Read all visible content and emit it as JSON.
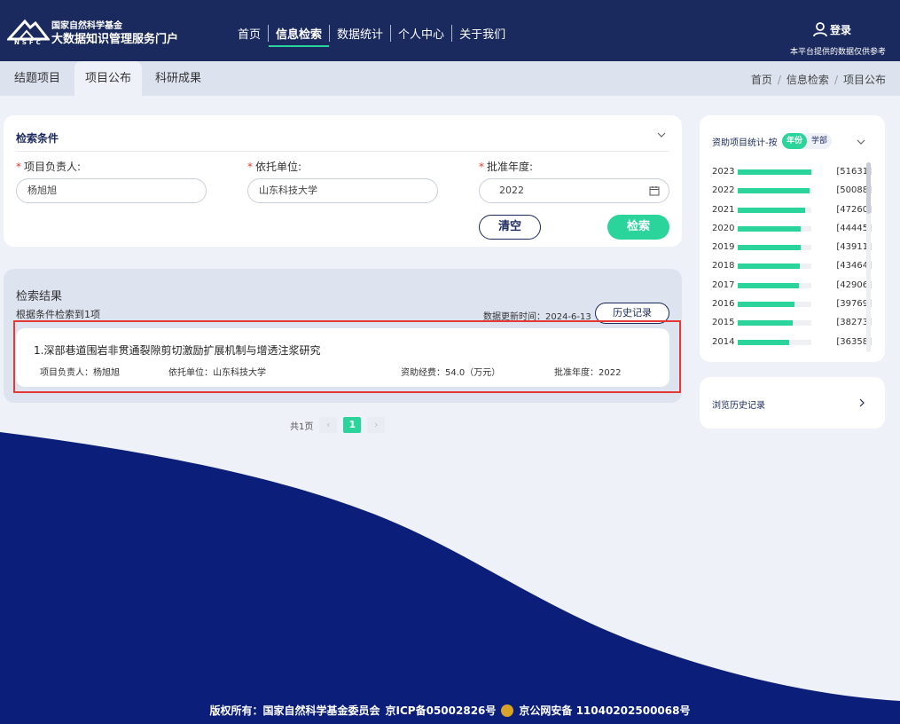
{
  "header": {
    "logo_abbr": "NSFC",
    "logo_line1": "国家自然科学基金",
    "logo_line2": "大数据知识管理服务门户",
    "nav": [
      "首页",
      "信息检索",
      "数据统计",
      "个人中心",
      "关于我们"
    ],
    "nav_active": "信息检索",
    "login_label": "登录",
    "disclaimer": "本平台提供的数据仅供参考"
  },
  "tabs": [
    "结题项目",
    "项目公布",
    "科研成果"
  ],
  "tab_active": "项目公布",
  "breadcrumb": [
    "首页",
    "信息检索",
    "项目公布"
  ],
  "search": {
    "title": "检索条件",
    "fields": [
      {
        "label": "项目负责人:",
        "value": "杨旭旭",
        "required": "*"
      },
      {
        "label": "依托单位:",
        "value": "山东科技大学",
        "required": "*"
      },
      {
        "label": "批准年度:",
        "value": "2022",
        "required": "*"
      }
    ],
    "clear_label": "清空",
    "search_label": "检索"
  },
  "results": {
    "title": "检索结果",
    "count_text": "根据条件检索到1项",
    "update_text": "数据更新时间：2024-6-13",
    "history_label": "历史记录",
    "items": [
      {
        "title": "1.深部巷道围岩非贯通裂隙剪切激励扩展机制与增透注浆研究",
        "leader": "项目负责人：杨旭旭",
        "unit": "依托单位：山东科技大学",
        "funding": "资助经费：54.0（万元）",
        "year": "批准年度：2022"
      }
    ]
  },
  "pager": {
    "total_text": "共1页",
    "prev": "‹",
    "current": "1",
    "next": "›"
  },
  "stats": {
    "title": "资助项目统计-按",
    "toggle_on": "年份",
    "toggle_off": "学部",
    "max": 51631,
    "rows": [
      {
        "year": "2023",
        "count": 51631,
        "label": "[51631]"
      },
      {
        "year": "2022",
        "count": 50088,
        "label": "[50088]"
      },
      {
        "year": "2021",
        "count": 47260,
        "label": "[47260]"
      },
      {
        "year": "2020",
        "count": 44445,
        "label": "[44445]"
      },
      {
        "year": "2019",
        "count": 43911,
        "label": "[43911]"
      },
      {
        "year": "2018",
        "count": 43464,
        "label": "[43464]"
      },
      {
        "year": "2017",
        "count": 42906,
        "label": "[42906]"
      },
      {
        "year": "2016",
        "count": 39769,
        "label": "[39769]"
      },
      {
        "year": "2015",
        "count": 38273,
        "label": "[38273]"
      },
      {
        "year": "2014",
        "count": 36358,
        "label": "[36358]"
      }
    ]
  },
  "history_link": "浏览历史记录",
  "footer": {
    "copyright": "版权所有：国家自然科学基金委员会",
    "icp": "京ICP备05002826号",
    "police": "京公网安备 11040202500068号"
  },
  "colors": {
    "navy": "#1b2a5e",
    "accent": "#2bd49a",
    "highlight": "#e53935"
  }
}
